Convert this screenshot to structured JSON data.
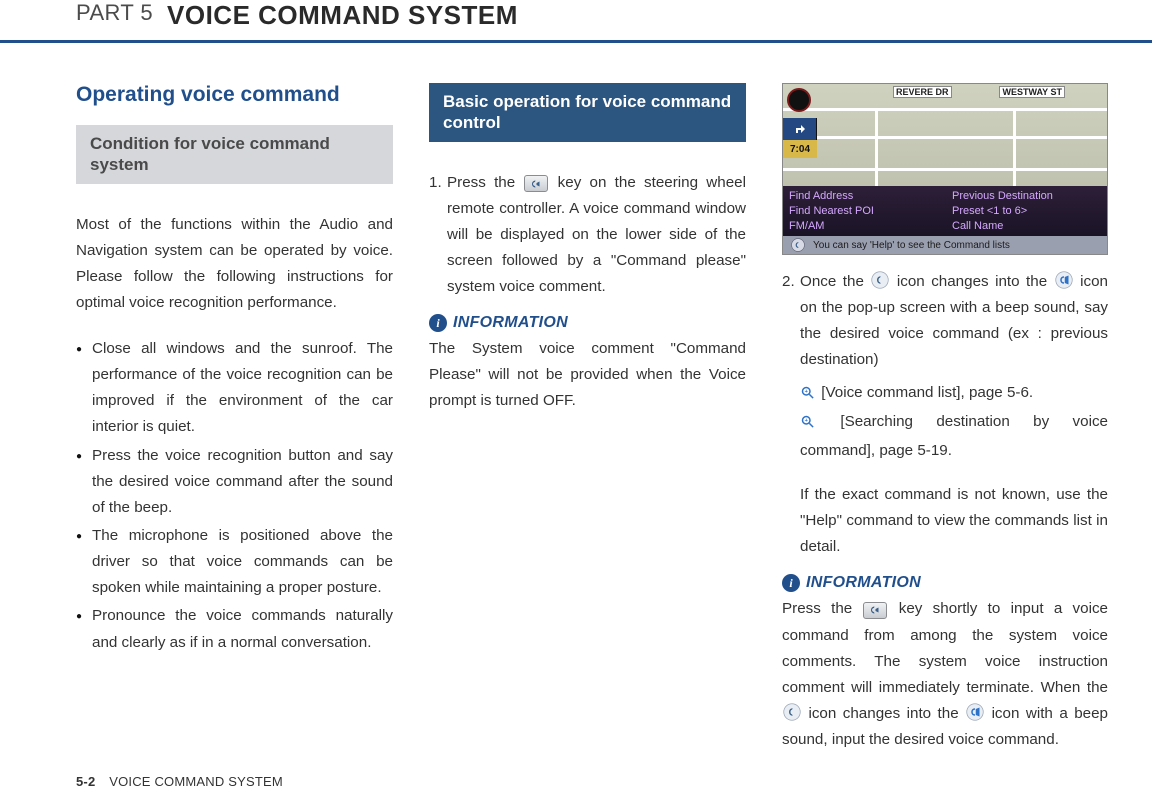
{
  "header": {
    "part": "PART 5",
    "title": "VOICE COMMAND SYSTEM"
  },
  "footer": {
    "page": "5-2",
    "section": "VOICE COMMAND SYSTEM"
  },
  "col1": {
    "section_title": "Operating voice command",
    "subhead": "Condition for voice command system",
    "intro": "Most of the functions within the Audio and Navigation system can be operated by voice. Please follow the following instructions for optimal voice recognition performance.",
    "bullets": [
      "Close all windows and the sunroof. The performance of the voice recognition can be improved if the environment of the car interior is quiet.",
      "Press the voice recognition button and say the desired voice command after the sound of the beep.",
      "The microphone is positioned above the driver so that voice commands can be spoken while maintaining a proper posture.",
      "Pronounce the voice commands naturally and clearly as if in a normal conversation."
    ]
  },
  "col2": {
    "subhead": "Basic operation for voice command control",
    "step1_a": "Press the ",
    "step1_b": " key on the steering wheel remote controller. A voice command window will be displayed on the lower side of the screen followed by a \"Command please\" system voice comment.",
    "info_label": "INFORMATION",
    "info_text": "The System voice comment \"Command Please\" will not be provided when the Voice prompt is turned OFF."
  },
  "col3": {
    "shot": {
      "street1": "REVERE DR",
      "street2": "WESTWAY ST",
      "time": "7:04",
      "menu": [
        "Find Address",
        "Previous Destination",
        "Find Nearest POI",
        "Preset <1 to 6>",
        "FM/AM",
        "Call Name"
      ],
      "hint": "You can say 'Help' to see the Command lists"
    },
    "step2_a": "Once the ",
    "step2_b": " icon changes into the ",
    "step2_c": " icon on the pop-up screen with a beep sound, say the desired voice command (ex : previous destination)",
    "ref1": "[Voice command list], page 5-6.",
    "ref2": "[Searching destination by voice command], page 5-19.",
    "help_para": "If the exact command is not known, use the \"Help\" command to view the commands list in detail.",
    "info_label": "INFORMATION",
    "info2_a": "Press the ",
    "info2_b": " key shortly to input a voice command from among the system voice comments. The system voice instruction comment will immediately terminate. When the ",
    "info2_c": " icon changes into the ",
    "info2_d": " icon with a beep sound, input the desired voice command."
  }
}
